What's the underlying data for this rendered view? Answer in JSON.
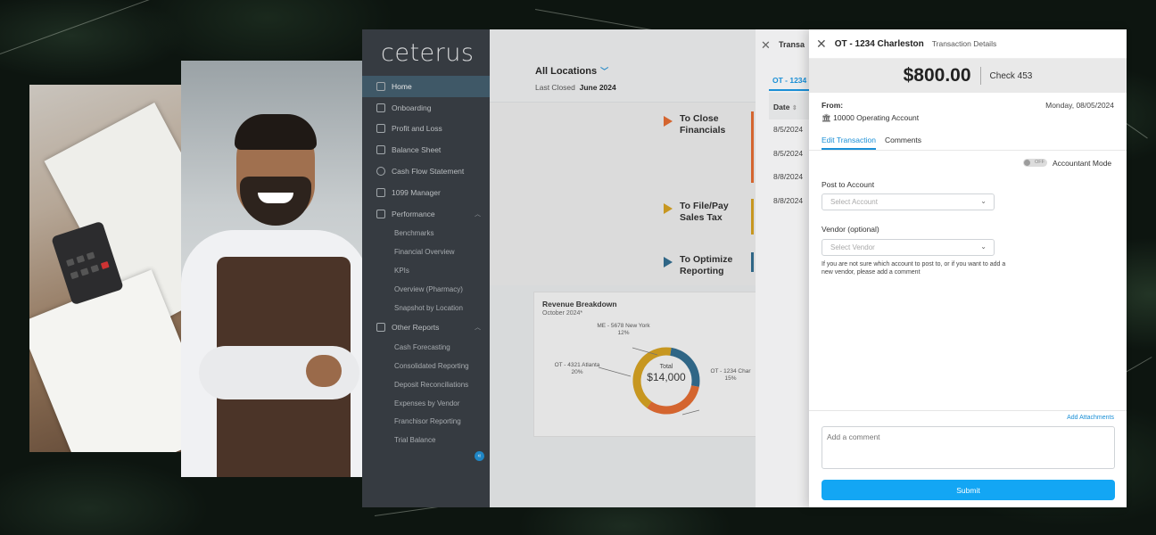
{
  "sidebar": {
    "logo": "ceterus",
    "items": [
      {
        "label": "Home",
        "icon": "home-icon",
        "active": true
      },
      {
        "label": "Onboarding",
        "icon": "onboarding-icon"
      },
      {
        "label": "Profit and Loss",
        "icon": "bar-chart-icon"
      },
      {
        "label": "Balance Sheet",
        "icon": "scale-icon"
      },
      {
        "label": "Cash Flow Statement",
        "icon": "dollar-icon"
      },
      {
        "label": "1099 Manager",
        "icon": "document-icon"
      },
      {
        "label": "Performance",
        "icon": "line-chart-icon",
        "expanded": true
      },
      {
        "label": "Other Reports",
        "icon": "report-icon",
        "expanded": true
      }
    ],
    "performance_sub": [
      "Benchmarks",
      "Financial Overview",
      "KPIs",
      "Overview (Pharmacy)",
      "Snapshot by Location"
    ],
    "other_reports_sub": [
      "Cash Forecasting",
      "Consolidated Reporting",
      "Deposit Reconciliations",
      "Expenses by Vendor",
      "Franchisor Reporting",
      "Trial Balance"
    ]
  },
  "main": {
    "location": "All Locations",
    "last_closed_label": "Last Closed",
    "last_closed_value": "June 2024",
    "tasks": [
      {
        "line1": "To Close",
        "line2": "Financials",
        "color": "#e8692c"
      },
      {
        "line1": "To File/Pay",
        "line2": "Sales Tax",
        "color": "#d9a21b"
      },
      {
        "line1": "To Optimize",
        "line2": "Reporting",
        "color": "#2c6a8f"
      }
    ],
    "revenue": {
      "title": "Revenue Breakdown",
      "subtitle": "October 2024*",
      "total_label": "Total",
      "total_value": "$14,000",
      "labels": [
        {
          "name": "ME - 5678 New York",
          "pct": "12%"
        },
        {
          "name": "OT - 4321 Atlanta",
          "pct": "20%"
        },
        {
          "name": "OT - 1234 Char",
          "pct": "15%"
        }
      ]
    }
  },
  "chart_data": {
    "type": "pie",
    "title": "Revenue Breakdown",
    "subtitle": "October 2024*",
    "categories": [
      "ME - 5678 New York",
      "OT - 4321 Atlanta",
      "OT - 1234 Char"
    ],
    "values": [
      12,
      20,
      15
    ],
    "colors": [
      "#2c6a8f",
      "#d9a21b",
      "#e8692c"
    ]
  },
  "txlist": {
    "title": "Transa",
    "tab": "OT - 1234",
    "date_header": "Date",
    "rows": [
      "8/5/2024",
      "8/5/2024",
      "8/8/2024",
      "8/8/2024"
    ]
  },
  "panel": {
    "title": "OT - 1234 Charleston",
    "subtitle": "Transaction Details",
    "amount": "$800.00",
    "check": "Check 453",
    "from_label": "From:",
    "date": "Monday, 08/05/2024",
    "account": "10000 Operating Account",
    "tabs": [
      "Edit Transaction",
      "Comments"
    ],
    "toggle_text": "OFF",
    "accountant_mode": "Accountant Mode",
    "post_to_account_label": "Post to Account",
    "post_to_account_placeholder": "Select Account",
    "vendor_label": "Vendor (optional)",
    "vendor_placeholder": "Select Vendor",
    "hint": "If you are not sure which account to post to, or if you want to add a new vendor, please add a comment",
    "add_attachments": "Add Attachments",
    "comment_placeholder": "Add a comment",
    "submit": "Submit"
  }
}
